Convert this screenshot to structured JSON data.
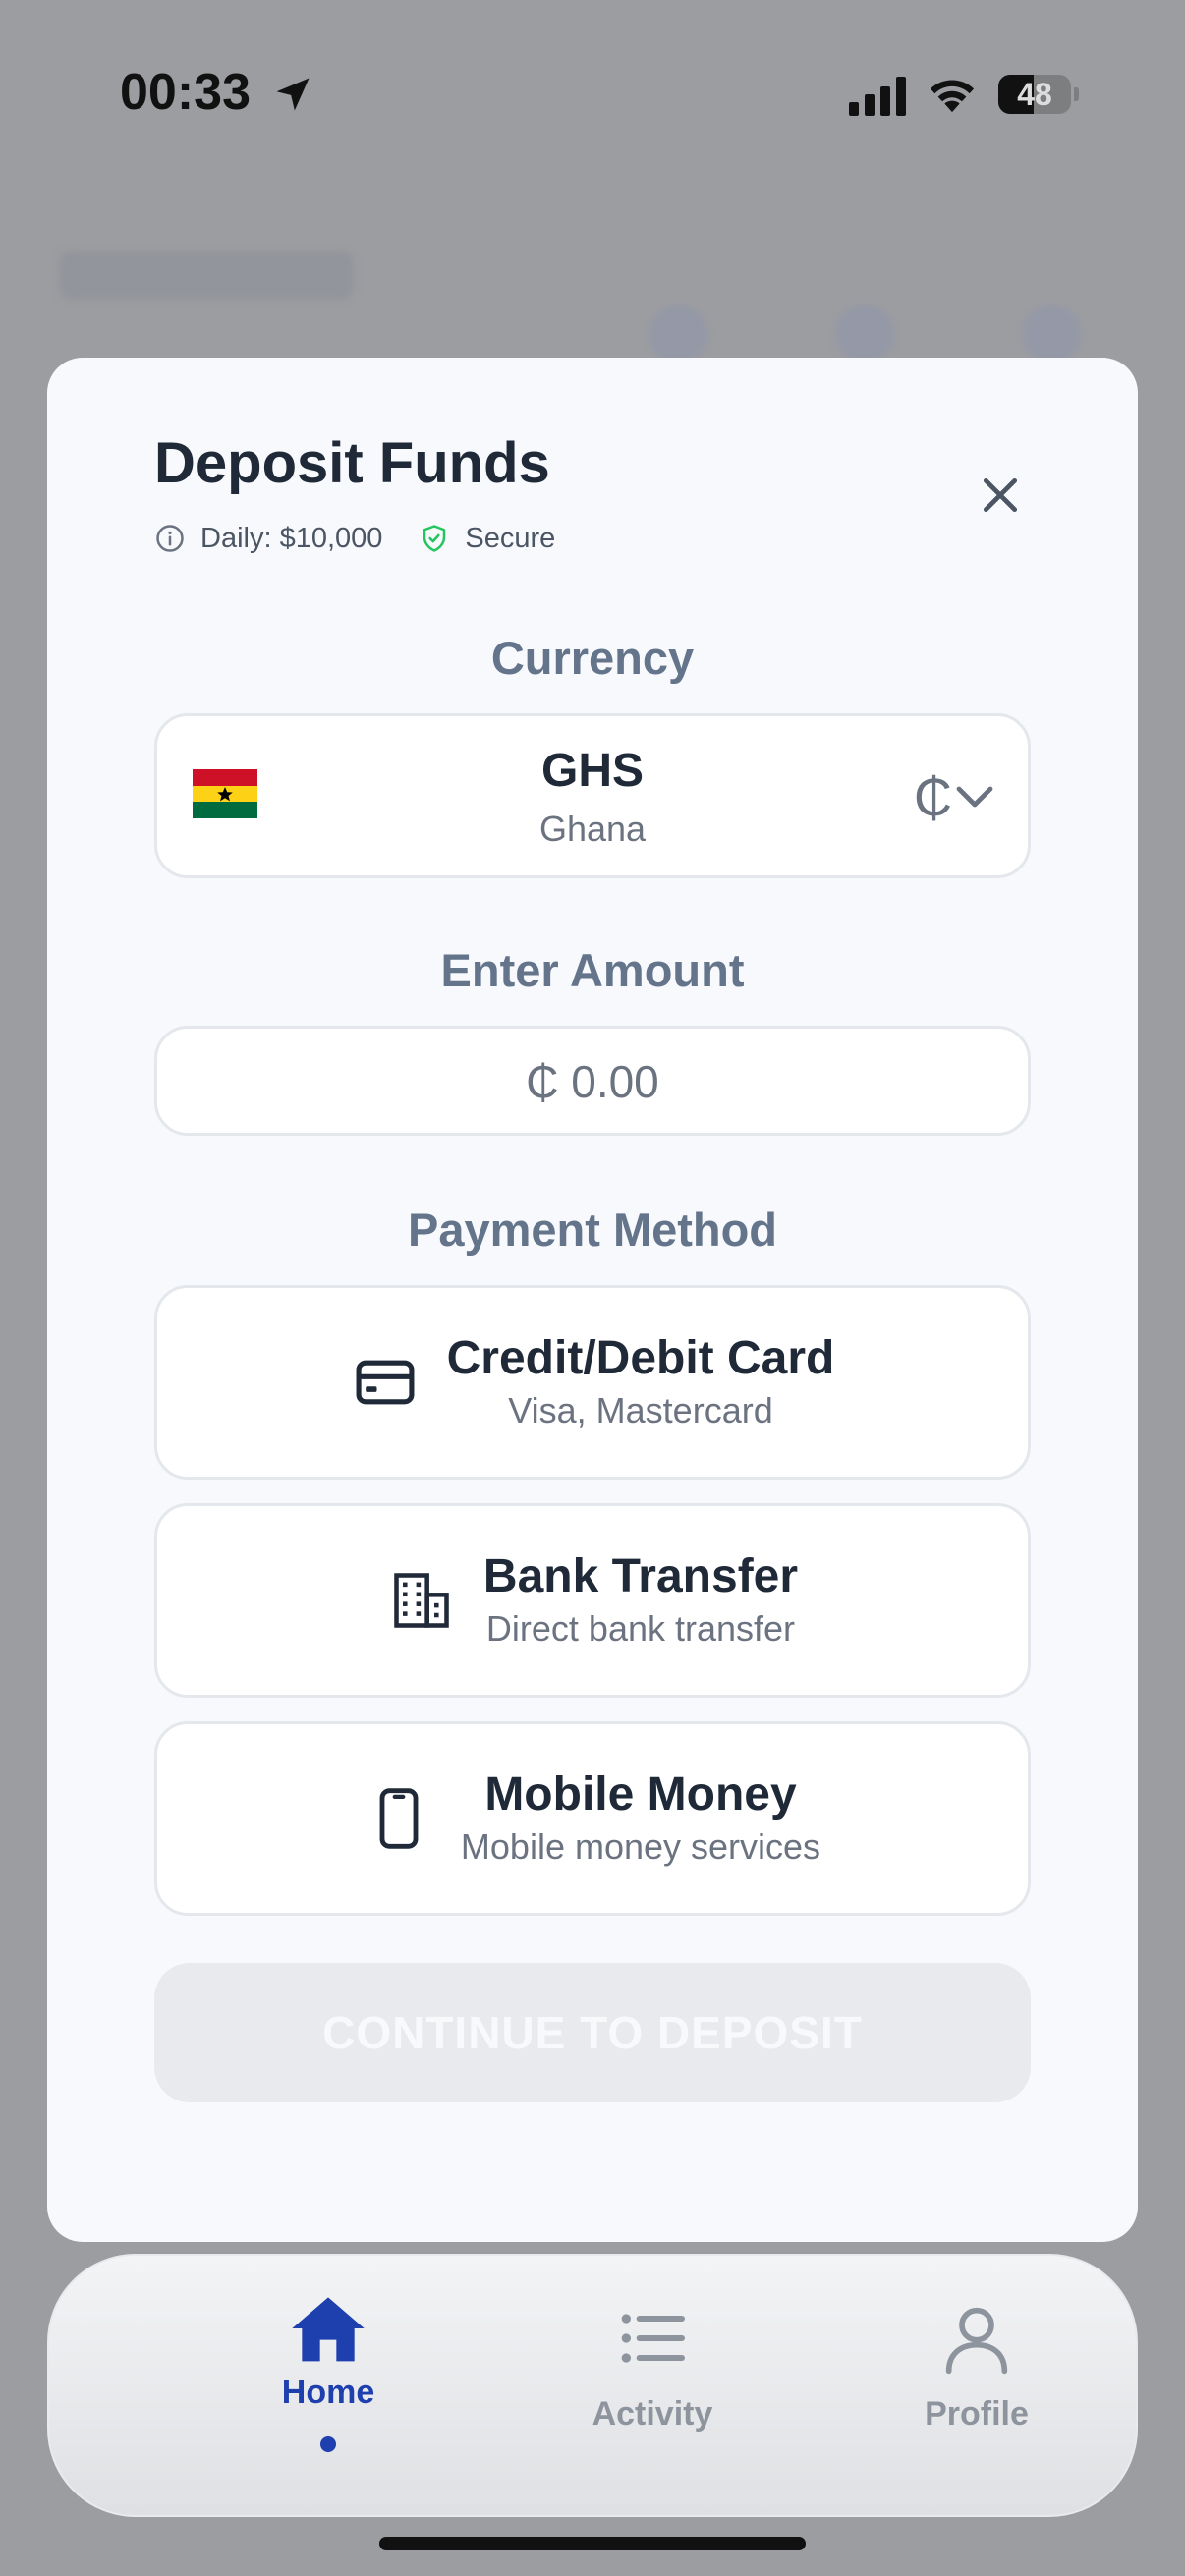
{
  "status_bar": {
    "time": "00:33",
    "battery": "48",
    "battery_level": 0.48
  },
  "modal": {
    "title": "Deposit Funds",
    "daily_limit": "Daily: $10,000",
    "secure_label": "Secure",
    "currency_section": {
      "label": "Currency",
      "code": "GHS",
      "country": "Ghana",
      "symbol": "₵",
      "flag": "ghana-flag"
    },
    "amount_section": {
      "label": "Enter Amount",
      "placeholder": "₵ 0.00"
    },
    "payment_section": {
      "label": "Payment Method",
      "methods": [
        {
          "title": "Credit/Debit Card",
          "subtitle": "Visa, Mastercard",
          "icon": "credit-card-icon"
        },
        {
          "title": "Bank Transfer",
          "subtitle": "Direct bank transfer",
          "icon": "building-icon"
        },
        {
          "title": "Mobile Money",
          "subtitle": "Mobile money services",
          "icon": "mobile-phone-icon"
        }
      ]
    },
    "continue_label": "CONTINUE TO DEPOSIT"
  },
  "tabbar": {
    "tabs": [
      {
        "label": "Home",
        "icon": "home-icon",
        "active": true
      },
      {
        "label": "Activity",
        "icon": "list-icon",
        "active": false
      },
      {
        "label": "Profile",
        "icon": "user-icon",
        "active": false
      }
    ]
  },
  "colors": {
    "accent": "#1e3fae",
    "secure_green": "#22c55e",
    "muted": "#64748b"
  }
}
